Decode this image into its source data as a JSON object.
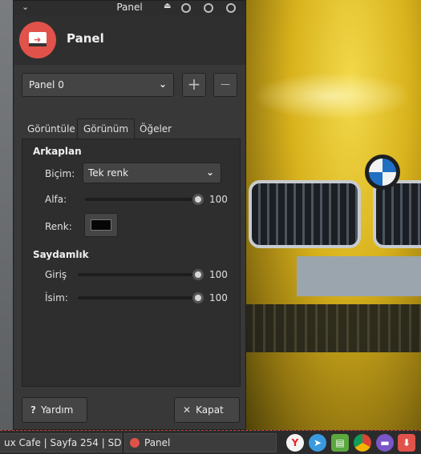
{
  "window": {
    "title": "Panel",
    "header_title": "Panel"
  },
  "panel_select": {
    "value": "Panel 0",
    "add_label": "+",
    "remove_label": "—"
  },
  "tabs": [
    {
      "label": "Görüntüle",
      "active": false
    },
    {
      "label": "Görünüm",
      "active": true
    },
    {
      "label": "Öğeler",
      "active": false
    }
  ],
  "background_section": {
    "heading": "Arkaplan",
    "style_label": "Biçim:",
    "style_value": "Tek renk",
    "alpha_label": "Alfa:",
    "alpha_value": "100",
    "color_label": "Renk:",
    "color_hex": "#060606"
  },
  "transparency_section": {
    "heading": "Saydamlık",
    "enter_label": "Giriş",
    "enter_value": "100",
    "leave_label": "İsim:",
    "leave_value": "100"
  },
  "buttons": {
    "help": "Yardım",
    "close": "Kapat"
  },
  "taskbar": {
    "task1": "ux Cafe | Sayfa 254 | SD...",
    "task2": "Panel"
  },
  "colors": {
    "accent": "#e0524a",
    "window_bg": "#383838"
  }
}
